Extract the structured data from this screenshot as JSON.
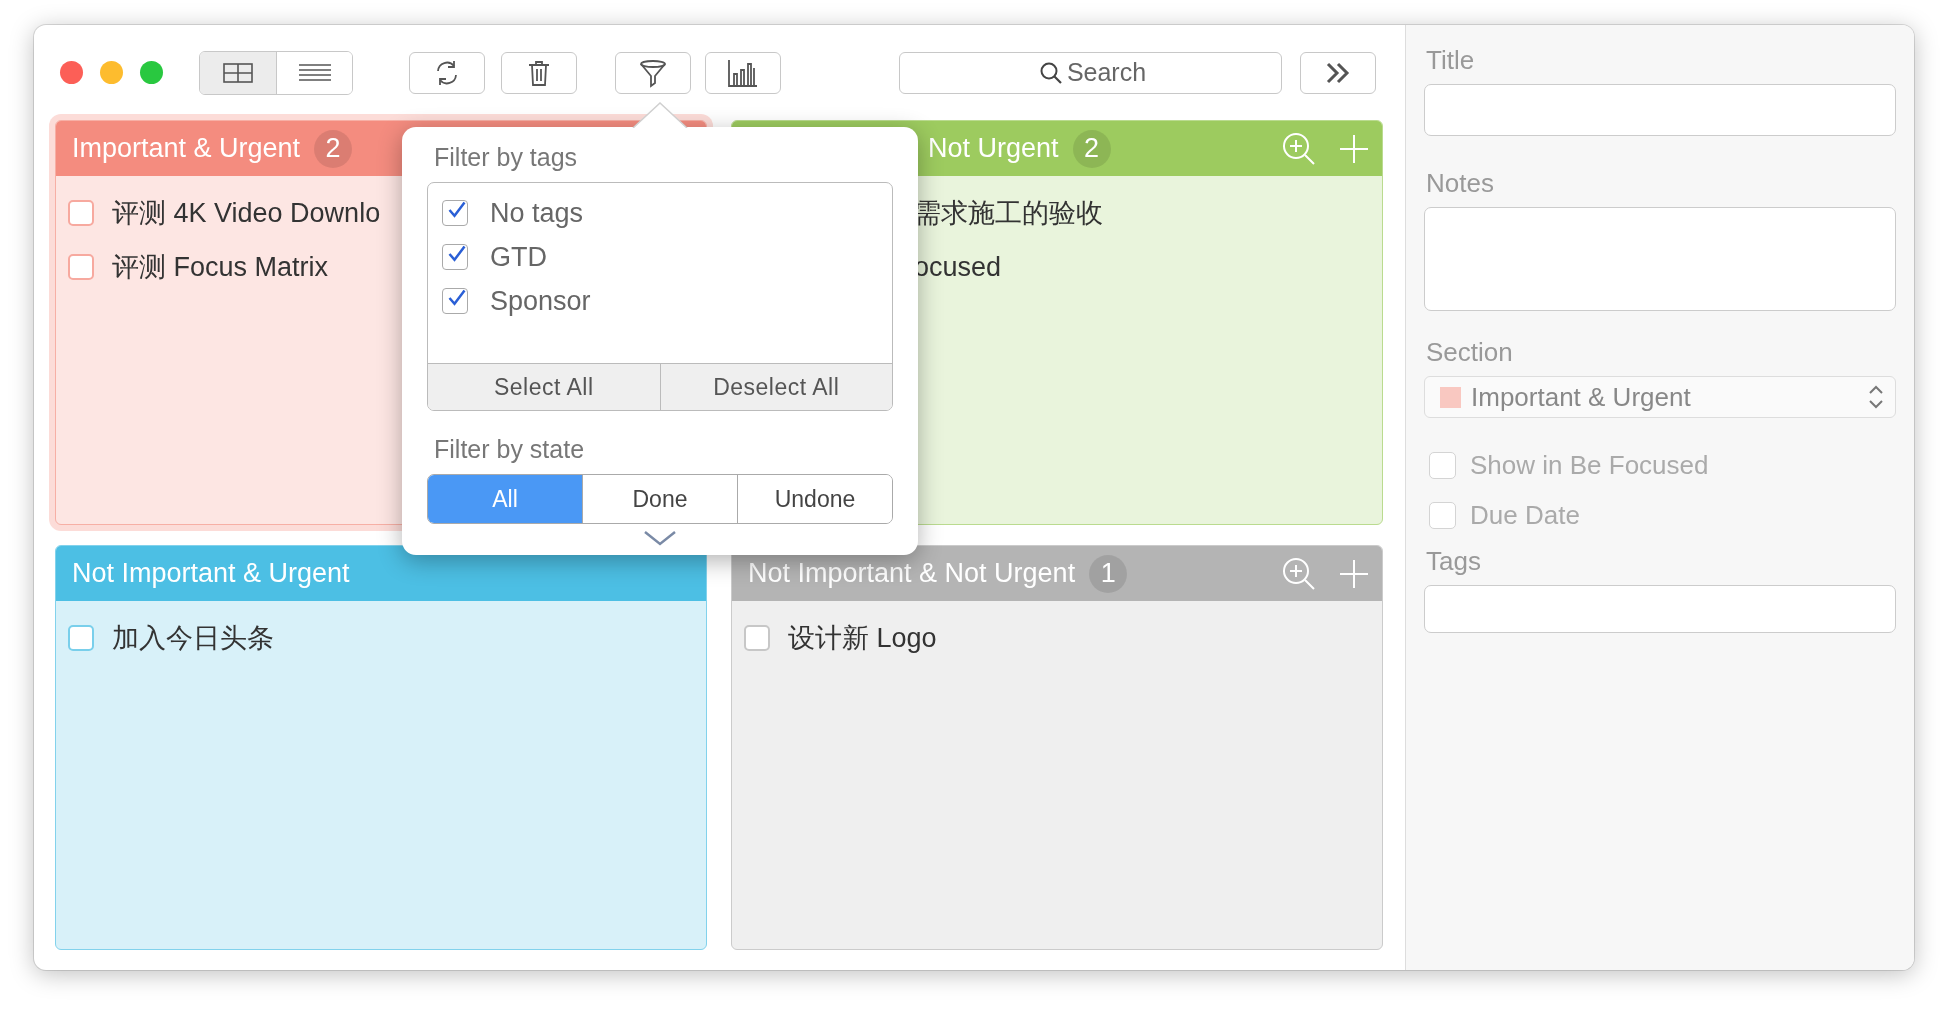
{
  "toolbar": {
    "view_modes": [
      {
        "kind": "grid",
        "selected": true
      },
      {
        "kind": "list",
        "selected": false
      }
    ],
    "buttons": [
      {
        "kind": "refresh"
      },
      {
        "kind": "trash"
      },
      {
        "kind": "filter"
      },
      {
        "kind": "chart"
      }
    ],
    "search": {
      "placeholder": "Search"
    }
  },
  "quadrants": [
    {
      "title": "Important & Urgent",
      "count": "2",
      "color": "#f48c7f",
      "selected": true,
      "items": [
        {
          "text": "评测 4K Video Downlo",
          "checked": false
        },
        {
          "text": "评测 Focus Matrix",
          "checked": false
        }
      ]
    },
    {
      "title": "Not Urgent",
      "count": "2",
      "color": "#9dcb5f",
      "selected": false,
      "actions": true,
      "items": [
        {
          "text": "需求施工的验收"
        },
        {
          "text": "ocused"
        }
      ]
    },
    {
      "title": "Not Important & Urgent",
      "color": "#4cbfe4",
      "selected": false,
      "items": [
        {
          "text": "加入今日头条",
          "checked": false
        }
      ]
    },
    {
      "title": "Not Important & Not Urgent",
      "count": "1",
      "color": "#b4b4b4",
      "selected": false,
      "actions": true,
      "items": [
        {
          "text": "设计新 Logo",
          "checked": false
        }
      ]
    }
  ],
  "filter_popover": {
    "tags_title": "Filter by tags",
    "tags": [
      {
        "label": "No tags",
        "checked": true
      },
      {
        "label": "GTD",
        "checked": true
      },
      {
        "label": "Sponsor",
        "checked": true
      }
    ],
    "tag_buttons": [
      "Select All",
      "Deselect All"
    ],
    "state_title": "Filter by state",
    "states": [
      {
        "label": "All",
        "selected": true
      },
      {
        "label": "Done",
        "selected": false
      },
      {
        "label": "Undone",
        "selected": false
      }
    ]
  },
  "sidebar": {
    "title_label": "Title",
    "notes_label": "Notes",
    "section_label": "Section",
    "section": {
      "value": "Important & Urgent",
      "color": "#f9c8c1"
    },
    "options": [
      {
        "label": "Show in Be Focused",
        "checked": false
      },
      {
        "label": "Due Date",
        "checked": false
      }
    ],
    "tags_label": "Tags"
  }
}
